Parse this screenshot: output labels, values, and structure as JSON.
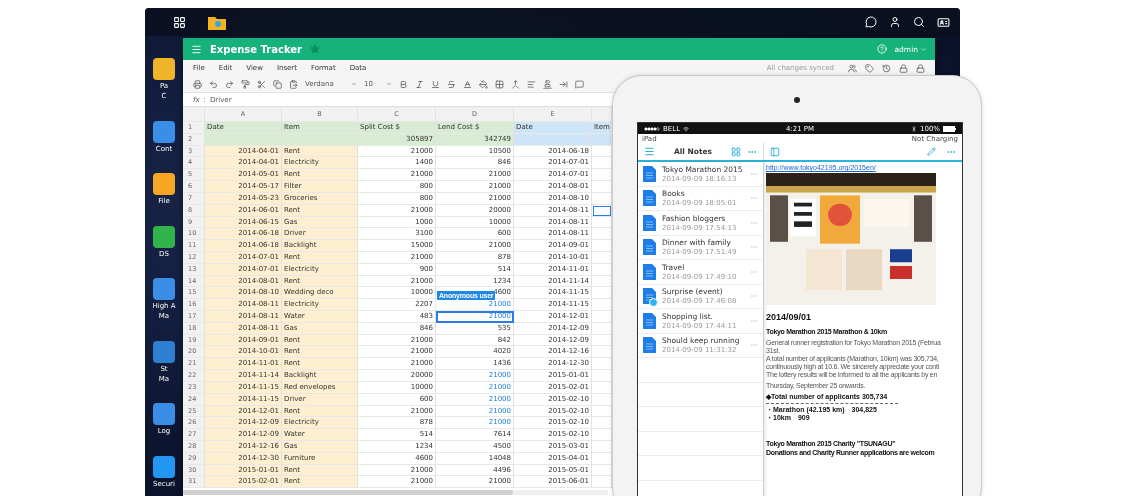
{
  "desktop_icons": [
    {
      "lines": [
        "Pa",
        "C"
      ],
      "color": "#f0b429"
    },
    {
      "lines": [
        "Cont"
      ],
      "color": "#3a8ee6"
    },
    {
      "lines": [
        "File"
      ],
      "color": "#f5a623"
    },
    {
      "lines": [
        "DS"
      ],
      "color": "#2fb34a"
    },
    {
      "lines": [
        "High A",
        "Ma"
      ],
      "color": "#3a8ee6"
    },
    {
      "lines": [
        "St",
        "Ma"
      ],
      "color": "#2f7fd0"
    },
    {
      "lines": [
        "Log"
      ],
      "color": "#3a8ee6"
    },
    {
      "lines": [
        "Securi"
      ],
      "color": "#2196f3"
    }
  ],
  "sheet": {
    "title": "Expense Tracker",
    "user": "admin",
    "menu": [
      "File",
      "Edit",
      "View",
      "Insert",
      "Format",
      "Data"
    ],
    "sync_status": "All changes synced",
    "font": "Verdana",
    "font_size": "10",
    "formula": {
      "label": "fx",
      "separator": ":",
      "value": "Driver"
    },
    "columns": [
      "A",
      "B",
      "C",
      "D",
      "E"
    ],
    "title_row": {
      "number": "1",
      "date": "Date",
      "item": "Item",
      "split": "Split Cost $",
      "lend": "Lend Cost $",
      "date2": "Date",
      "item2": "Item"
    },
    "totals_row": {
      "number": "2",
      "split": "305897",
      "lend": "342749"
    },
    "rows": [
      {
        "number": "3",
        "date": "2014-04-01",
        "item": "Rent",
        "split": "21000",
        "lend": "10500",
        "date2": "2014-06-18",
        "linked": false,
        "selected": false,
        "f_selected": false
      },
      {
        "number": "4",
        "date": "2014-04-01",
        "item": "Electricity",
        "split": "1400",
        "lend": "846",
        "date2": "2014-07-01",
        "linked": false,
        "selected": false,
        "f_selected": false
      },
      {
        "number": "5",
        "date": "2014-05-01",
        "item": "Rent",
        "split": "21000",
        "lend": "21000",
        "date2": "2014-07-01",
        "linked": false,
        "selected": false,
        "f_selected": false
      },
      {
        "number": "6",
        "date": "2014-05-17",
        "item": "Filter",
        "split": "800",
        "lend": "21000",
        "date2": "2014-08-01",
        "linked": false,
        "selected": false,
        "f_selected": false
      },
      {
        "number": "7",
        "date": "2014-05-23",
        "item": "Groceries",
        "split": "800",
        "lend": "21000",
        "date2": "2014-08-10",
        "linked": false,
        "selected": false,
        "f_selected": false
      },
      {
        "number": "8",
        "date": "2014-06-01",
        "item": "Rent",
        "split": "21000",
        "lend": "20000",
        "date2": "2014-08-11",
        "linked": false,
        "selected": false,
        "f_selected": true
      },
      {
        "number": "9",
        "date": "2014-06-15",
        "item": "Gas",
        "split": "1000",
        "lend": "10000",
        "date2": "2014-08-11",
        "linked": false,
        "selected": false,
        "f_selected": false
      },
      {
        "number": "10",
        "date": "2014-06-18",
        "item": "Driver",
        "split": "3100",
        "lend": "600",
        "date2": "2014-08-11",
        "linked": false,
        "selected": false,
        "f_selected": false
      },
      {
        "number": "11",
        "date": "2014-06-18",
        "item": "Backlight",
        "split": "15000",
        "lend": "21000",
        "date2": "2014-09-01",
        "linked": false,
        "selected": false,
        "f_selected": false
      },
      {
        "number": "12",
        "date": "2014-07-01",
        "item": "Rent",
        "split": "21000",
        "lend": "878",
        "date2": "2014-10-01",
        "linked": false,
        "selected": false,
        "f_selected": false
      },
      {
        "number": "13",
        "date": "2014-07-01",
        "item": "Electricity",
        "split": "900",
        "lend": "514",
        "date2": "2014-11-01",
        "linked": false,
        "selected": false,
        "f_selected": false
      },
      {
        "number": "14",
        "date": "2014-08-01",
        "item": "Rent",
        "split": "21000",
        "lend": "1234",
        "date2": "2014-11-14",
        "linked": false,
        "selected": false,
        "f_selected": false
      },
      {
        "number": "15",
        "date": "2014-08-10",
        "item": "Wedding deco",
        "split": "10000",
        "lend": "4600",
        "date2": "2014-11-15",
        "linked": false,
        "selected": false,
        "f_selected": false
      },
      {
        "number": "16",
        "date": "2014-08-11",
        "item": "Electricity",
        "split": "2207",
        "lend": "21000",
        "date2": "2014-11-15",
        "linked": true,
        "selected": false,
        "f_selected": false,
        "collaborator": "Anonymous user"
      },
      {
        "number": "17",
        "date": "2014-08-11",
        "item": "Water",
        "split": "483",
        "lend": "21000",
        "date2": "2014-12-01",
        "linked": true,
        "selected": true,
        "f_selected": false
      },
      {
        "number": "18",
        "date": "2014-08-11",
        "item": "Gas",
        "split": "846",
        "lend": "535",
        "date2": "2014-12-09",
        "linked": false,
        "selected": false,
        "f_selected": false
      },
      {
        "number": "19",
        "date": "2014-09-01",
        "item": "Rent",
        "split": "21000",
        "lend": "842",
        "date2": "2014-12-09",
        "linked": false,
        "selected": false,
        "f_selected": false
      },
      {
        "number": "20",
        "date": "2014-10-01",
        "item": "Rent",
        "split": "21000",
        "lend": "4020",
        "date2": "2014-12-16",
        "linked": false,
        "selected": false,
        "f_selected": false
      },
      {
        "number": "21",
        "date": "2014-11-01",
        "item": "Rent",
        "split": "21000",
        "lend": "1436",
        "date2": "2014-12-30",
        "linked": false,
        "selected": false,
        "f_selected": false
      },
      {
        "number": "22",
        "date": "2014-11-14",
        "item": "Backlight",
        "split": "20000",
        "lend": "21000",
        "date2": "2015-01-01",
        "linked": true,
        "selected": false,
        "f_selected": false
      },
      {
        "number": "23",
        "date": "2014-11-15",
        "item": "Red envelopes",
        "split": "10000",
        "lend": "21000",
        "date2": "2015-02-01",
        "linked": true,
        "selected": false,
        "f_selected": false
      },
      {
        "number": "24",
        "date": "2014-11-15",
        "item": "Driver",
        "split": "600",
        "lend": "21000",
        "date2": "2015-02-10",
        "linked": true,
        "selected": false,
        "f_selected": false
      },
      {
        "number": "25",
        "date": "2014-12-01",
        "item": "Rent",
        "split": "21000",
        "lend": "21000",
        "date2": "2015-02-10",
        "linked": true,
        "selected": false,
        "f_selected": false
      },
      {
        "number": "26",
        "date": "2014-12-09",
        "item": "Electricity",
        "split": "878",
        "lend": "21000",
        "date2": "2015-02-10",
        "linked": true,
        "selected": false,
        "f_selected": false
      },
      {
        "number": "27",
        "date": "2014-12-09",
        "item": "Water",
        "split": "514",
        "lend": "7614",
        "date2": "2015-02-10",
        "linked": false,
        "selected": false,
        "f_selected": false
      },
      {
        "number": "28",
        "date": "2014-12-16",
        "item": "Gas",
        "split": "1234",
        "lend": "4500",
        "date2": "2015-03-01",
        "linked": false,
        "selected": false,
        "f_selected": false
      },
      {
        "number": "29",
        "date": "2014-12-30",
        "item": "Furniture",
        "split": "4600",
        "lend": "14048",
        "date2": "2015-04-01",
        "linked": false,
        "selected": false,
        "f_selected": false
      },
      {
        "number": "30",
        "date": "2015-01-01",
        "item": "Rent",
        "split": "21000",
        "lend": "4496",
        "date2": "2015-05-01",
        "linked": false,
        "selected": false,
        "f_selected": false
      },
      {
        "number": "31",
        "date": "2015-02-01",
        "item": "Rent",
        "split": "21000",
        "lend": "21000",
        "date2": "2015-06-01",
        "linked": false,
        "selected": false,
        "f_selected": false
      }
    ]
  },
  "ipad": {
    "status": {
      "carrier": "BELL",
      "time": "4:21 PM",
      "battery": "100%"
    },
    "device_line": {
      "left": "iPad",
      "right": "Not Charging"
    },
    "notes_title": "All Notes",
    "notes": [
      {
        "title": "Tokyo Marathon 2015",
        "time": "2014-09-09 18:16:13",
        "shared": false
      },
      {
        "title": "Books",
        "time": "2014-09-09 18:05:01",
        "shared": false
      },
      {
        "title": "Fashion bloggers",
        "time": "2014-09-09 17:54:13",
        "shared": false
      },
      {
        "title": "Dinner with family",
        "time": "2014-09-09 17:51:49",
        "shared": false
      },
      {
        "title": "Travel",
        "time": "2014-09-09 17:49:10",
        "shared": false
      },
      {
        "title": "Surprise (event)",
        "time": "2014-09-09 17:46:08",
        "shared": true
      },
      {
        "title": "Shopping list.",
        "time": "2014-09-09 17:44:11",
        "shared": false
      },
      {
        "title": "Should keep running",
        "time": "2014-09-09 11:31:32",
        "shared": false
      }
    ],
    "note": {
      "url": "http://www.tokyo42195.org/2015en/",
      "date": "2014/09/01",
      "heading": "Tokyo Marathon 2015 Marathon & 10km",
      "paragraphs": [
        [
          "General runner registration for Tokyo Marathon 2015 (Februa",
          "31st.",
          "A total number of applicants (Marathon, 10km) was 305,734,",
          "continuously high at 10.6. We sincerely appreciate your conti",
          "The lottery results will be informed to all the applicants by en"
        ],
        [
          "Thursday, September 25 onwards."
        ]
      ],
      "total": "◆Total number of applicants 305,734",
      "stats": [
        "・Marathon (42.195 km)　304,825",
        "・10km　909"
      ],
      "charity_heading": "Tokyo Marathon 2015 Charity \"TSUNAGU\"",
      "charity_line": "Donations and Charity Runner applications are welcom"
    }
  }
}
